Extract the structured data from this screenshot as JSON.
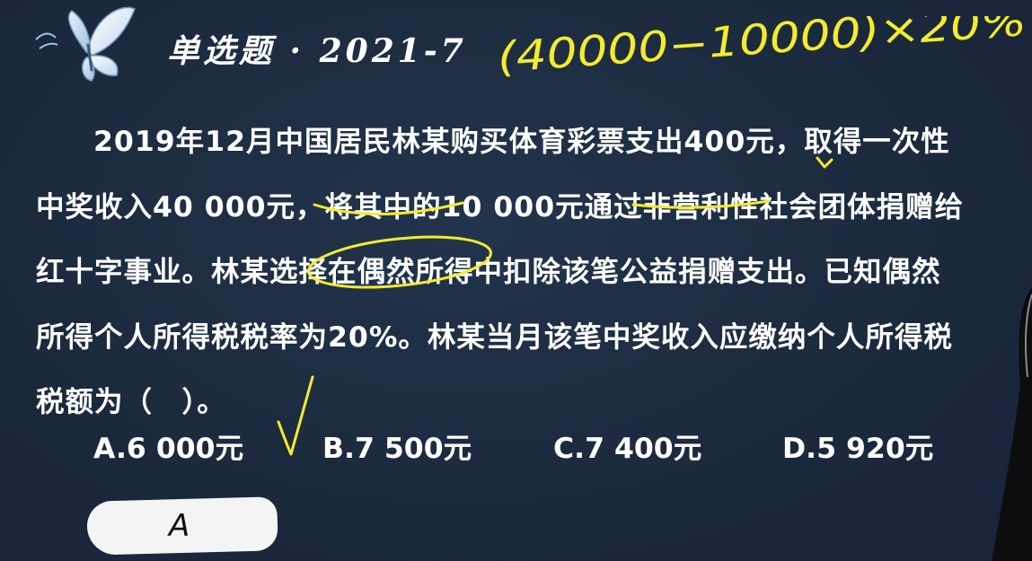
{
  "slide": {
    "title": "单选题 · 2021-7",
    "formula": "(40000−10000)×20%",
    "question": "2019年12月中国居民林某购买体育彩票支出400元，取得一次性中奖收入40 000元，将其中的10 000元通过非营利性社会团体捐赠给红十字事业。林某选择在偶然所得中扣除该笔公益捐赠支出。已知偶然所得个人所得税税率为20%。林某当月该笔中奖收入应缴纳个人所得税税额为（　）。",
    "options": [
      "A.6 000元",
      "B.7 500元",
      "C.7 400元",
      "D.5 920元"
    ],
    "answer": "A"
  },
  "colors": {
    "background": "#1c2a3e",
    "text": "#ffffff",
    "annotation": "#f4ec2a",
    "answer_box": "#f4f4f4"
  },
  "icons": {
    "decoration": "butterfly-icon"
  }
}
